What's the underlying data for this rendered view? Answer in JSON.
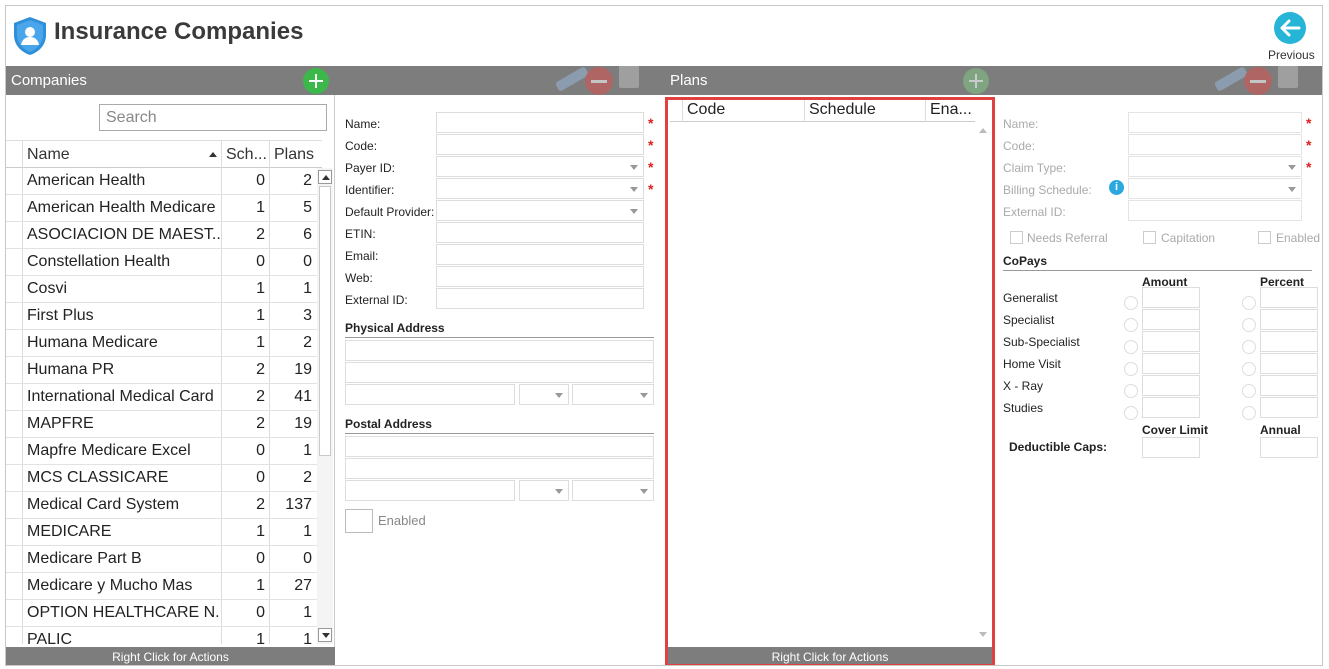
{
  "app": {
    "title": "Insurance Companies",
    "previous_label": "Previous",
    "accent_color": "#2f8fd8",
    "add_color": "#3cb84a",
    "highlight_color": "#e04040"
  },
  "companies": {
    "header": "Companies",
    "search_placeholder": "Search",
    "columns": [
      "Name",
      "Sch...",
      "Plans"
    ],
    "rows": [
      {
        "name": "American Health",
        "sch": "0",
        "plans": "2"
      },
      {
        "name": "American Health Medicare",
        "sch": "1",
        "plans": "5"
      },
      {
        "name": "ASOCIACION DE MAEST...",
        "sch": "2",
        "plans": "6"
      },
      {
        "name": "Constellation Health",
        "sch": "0",
        "plans": "0"
      },
      {
        "name": "Cosvi",
        "sch": "1",
        "plans": "1"
      },
      {
        "name": "First Plus",
        "sch": "1",
        "plans": "3"
      },
      {
        "name": "Humana Medicare",
        "sch": "1",
        "plans": "2"
      },
      {
        "name": "Humana PR",
        "sch": "2",
        "plans": "19"
      },
      {
        "name": "International Medical Card",
        "sch": "2",
        "plans": "41"
      },
      {
        "name": "MAPFRE",
        "sch": "2",
        "plans": "19"
      },
      {
        "name": "Mapfre Medicare Excel",
        "sch": "0",
        "plans": "1"
      },
      {
        "name": "MCS CLASSICARE",
        "sch": "0",
        "plans": "2"
      },
      {
        "name": "Medical Card System",
        "sch": "2",
        "plans": "137"
      },
      {
        "name": "MEDICARE",
        "sch": "1",
        "plans": "1"
      },
      {
        "name": "Medicare Part B",
        "sch": "0",
        "plans": "0"
      },
      {
        "name": "Medicare y Mucho Mas",
        "sch": "1",
        "plans": "27"
      },
      {
        "name": "OPTION HEALTHCARE N...",
        "sch": "0",
        "plans": "1"
      },
      {
        "name": "PALIC",
        "sch": "1",
        "plans": "1"
      }
    ],
    "footer": "Right Click for Actions"
  },
  "company_form": {
    "fields": {
      "name": "Name:",
      "code": "Code:",
      "payer_id": "Payer ID:",
      "identifier": "Identifier:",
      "default_provider": "Default Provider:",
      "etin": "ETIN:",
      "email": "Email:",
      "web": "Web:",
      "external_id": "External ID:"
    },
    "physical_address": "Physical Address",
    "postal_address": "Postal Address",
    "enabled_label": "Enabled",
    "required_mark": "*"
  },
  "plans": {
    "header": "Plans",
    "columns": [
      "Code",
      "Schedule",
      "Ena..."
    ],
    "footer": "Right Click for Actions"
  },
  "plan_form": {
    "fields": {
      "name": "Name:",
      "code": "Code:",
      "claim_type": "Claim Type:",
      "billing_schedule": "Billing Schedule:",
      "external_id": "External ID:"
    },
    "info_glyph": "i",
    "needs_referral": "Needs Referral",
    "capitation": "Capitation",
    "enabled": "Enabled",
    "copays_title": "CoPays",
    "amount_header": "Amount",
    "percent_header": "Percent",
    "copay_rows": [
      "Generalist",
      "Specialist",
      "Sub-Specialist",
      "Home Visit",
      "X - Ray",
      "Studies"
    ],
    "cover_limit_header": "Cover Limit",
    "annual_header": "Annual",
    "deductible_caps": "Deductible Caps:"
  }
}
